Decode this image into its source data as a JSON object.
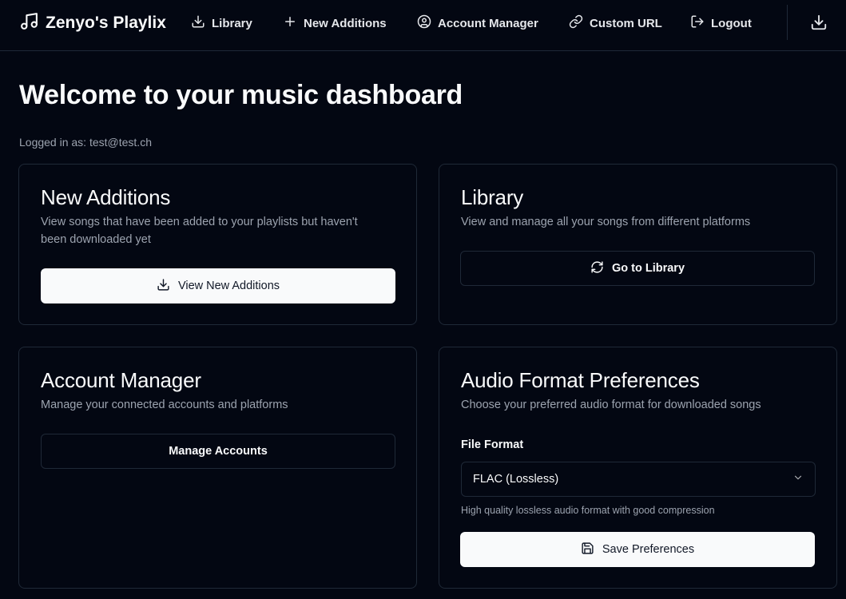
{
  "app": {
    "title": "Zenyo's Playlix",
    "logo_icon": "music-note-icon"
  },
  "nav": {
    "items": [
      {
        "label": "Library",
        "icon": "download-icon"
      },
      {
        "label": "New Additions",
        "icon": "plus-icon"
      },
      {
        "label": "Account Manager",
        "icon": "user-circle-icon"
      },
      {
        "label": "Custom URL",
        "icon": "link-icon"
      },
      {
        "label": "Logout",
        "icon": "logout-icon"
      }
    ],
    "download_icon": "download-icon"
  },
  "page": {
    "title": "Welcome to your music dashboard",
    "logged_in": "Logged in as: test@test.ch"
  },
  "cards": {
    "new_additions": {
      "title": "New Additions",
      "description_line1": "View songs that have been added to your playlists but haven't",
      "description_line2": "been downloaded yet",
      "button": "View New Additions"
    },
    "library": {
      "title": "Library",
      "description": "View and manage all your songs from different platforms",
      "button": "Go to Library"
    },
    "account_manager": {
      "title": "Account Manager",
      "description": "Manage your connected accounts and platforms",
      "button": "Manage Accounts"
    },
    "audio_format": {
      "title": "Audio Format Preferences",
      "description": "Choose your preferred audio format for downloaded songs",
      "field_label": "File Format",
      "selected_value": "FLAC (Lossless)",
      "hint": "High quality lossless audio format with good compression",
      "button": "Save Preferences"
    }
  },
  "colors": {
    "background": "#030712",
    "border": "#1f2937",
    "text": "#f9fafb",
    "muted": "#9ca3af",
    "button_light": "#f9fafb"
  }
}
